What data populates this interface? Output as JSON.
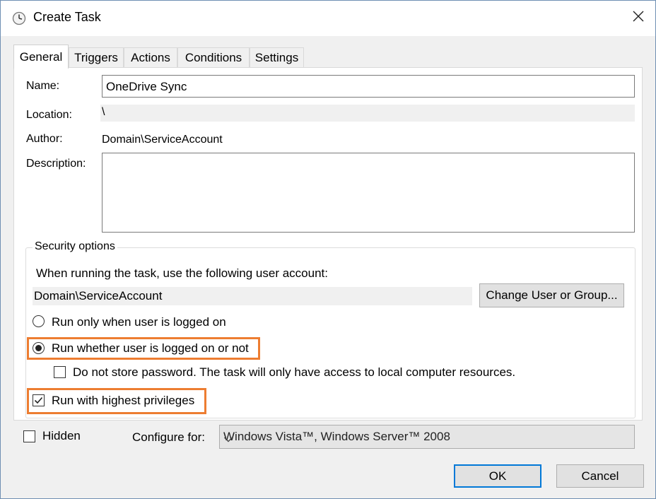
{
  "window": {
    "title": "Create Task"
  },
  "tabs": [
    "General",
    "Triggers",
    "Actions",
    "Conditions",
    "Settings"
  ],
  "general": {
    "name_label": "Name:",
    "name_value": "OneDrive Sync",
    "location_label": "Location:",
    "location_value": "\\",
    "author_label": "Author:",
    "author_value": "Domain\\ServiceAccount",
    "description_label": "Description:",
    "description_value": ""
  },
  "security": {
    "legend": "Security options",
    "account_prompt": "When running the task, use the following user account:",
    "account_value": "Domain\\ServiceAccount",
    "change_user_button": "Change User or Group...",
    "radio_logged_on": "Run only when user is logged on",
    "radio_whether": "Run whether user is logged on or not",
    "radio_selected": "whether",
    "no_store_password": "Do not store password.  The task will only have access to local computer resources.",
    "no_store_password_checked": false,
    "highest_privileges": "Run with highest privileges",
    "highest_privileges_checked": true
  },
  "footer": {
    "hidden_label": "Hidden",
    "hidden_checked": false,
    "configure_label": "Configure for:",
    "configure_value": "Windows Vista™, Windows Server™ 2008",
    "ok_button": "OK",
    "cancel_button": "Cancel"
  },
  "colors": {
    "highlight": "#ed7d31",
    "default_button_border": "#0078d7"
  },
  "icons": {
    "title": "clock-icon",
    "close": "close-icon",
    "dropdown": "chevron-down-icon",
    "checkmark": "checkmark-icon"
  }
}
